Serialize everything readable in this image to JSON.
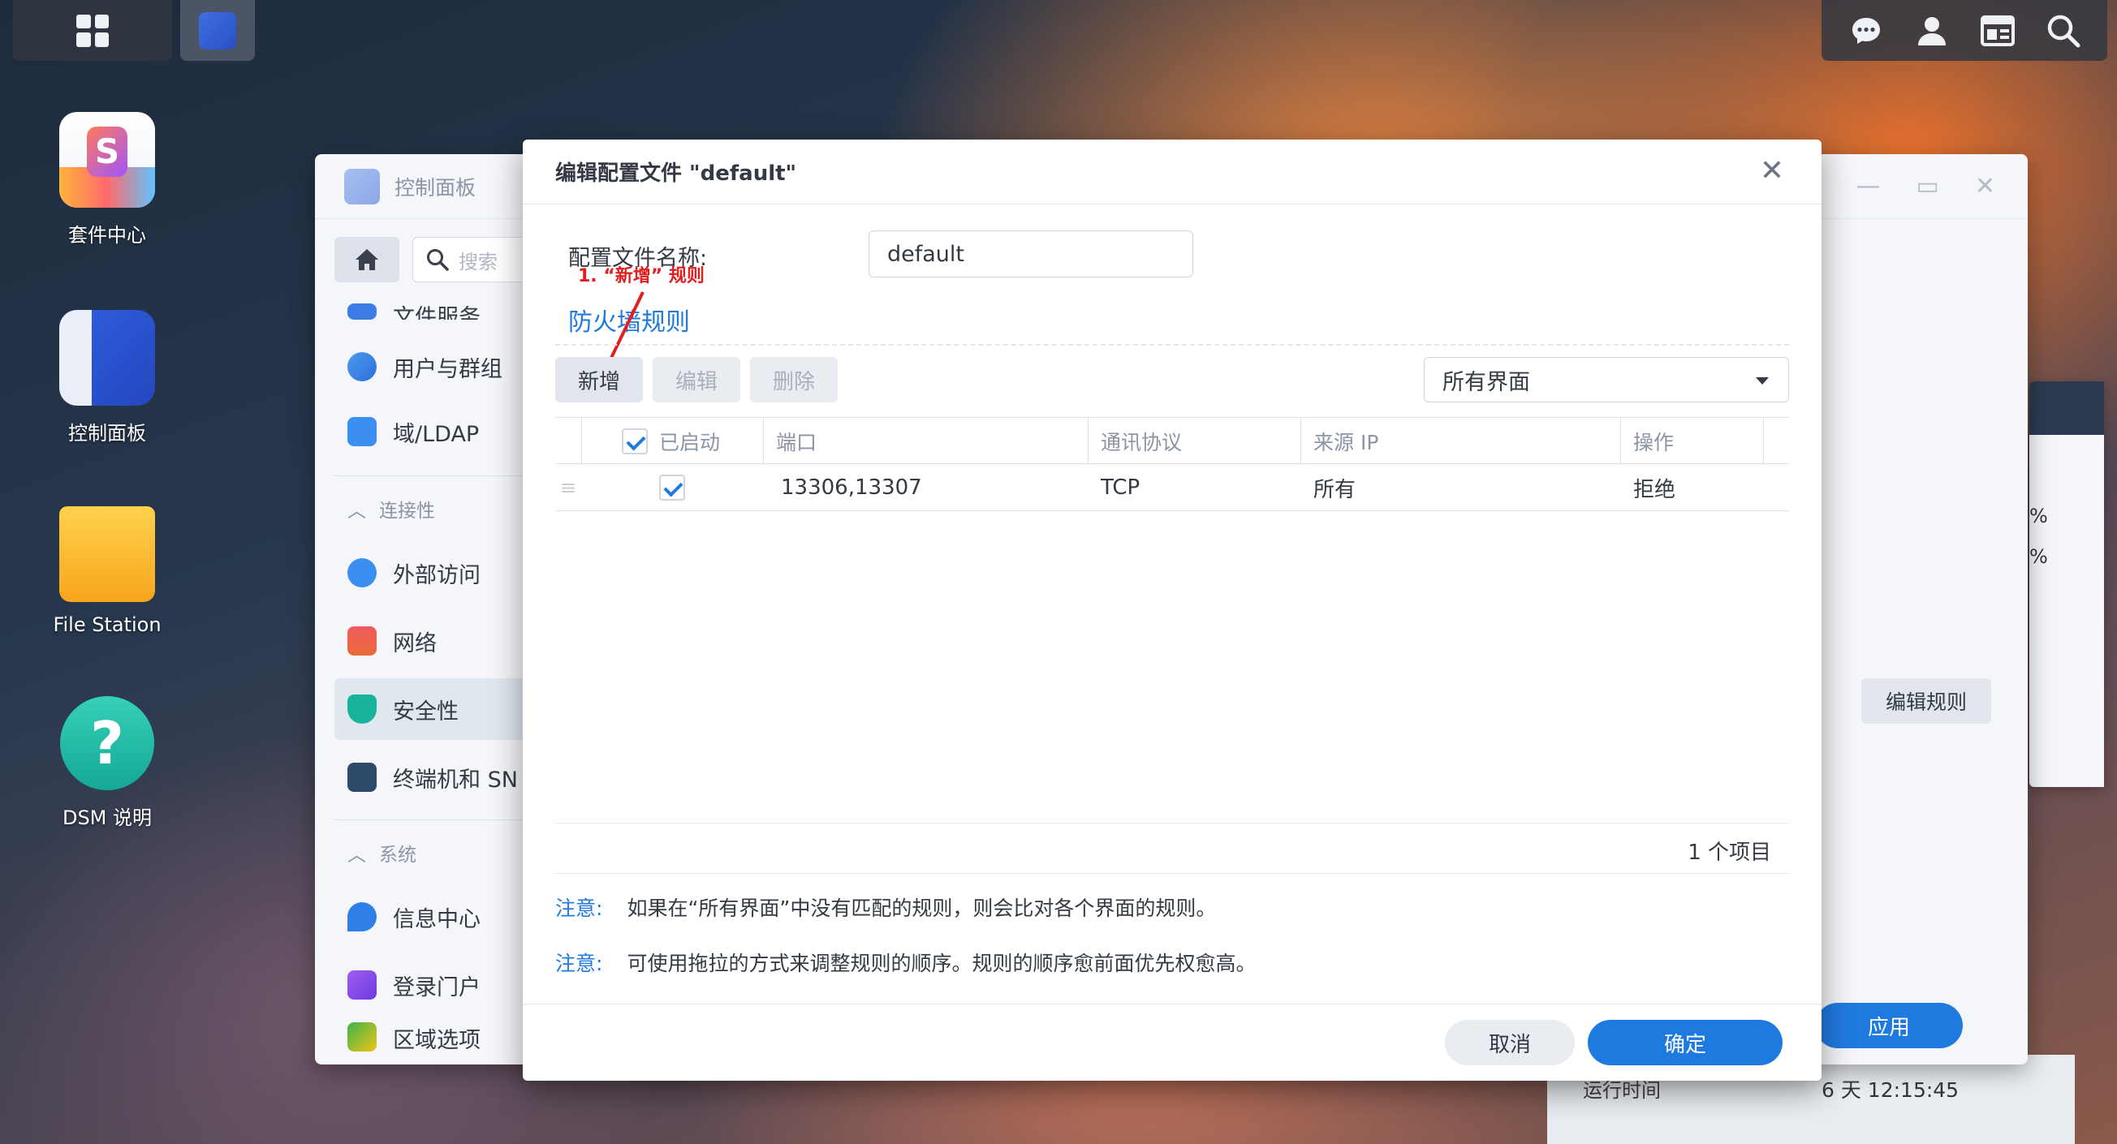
{
  "desktop": {
    "icons": [
      {
        "label": "套件中心"
      },
      {
        "label": "控制面板"
      },
      {
        "label": "File Station"
      },
      {
        "label": "DSM 说明"
      }
    ]
  },
  "control_panel": {
    "title": "控制面板",
    "search_placeholder": "搜索",
    "sidebar": {
      "partial_top_item": "文件服务",
      "items": [
        {
          "label": "用户与群组"
        },
        {
          "label": "域/LDAP"
        }
      ],
      "section_connectivity": "连接性",
      "connectivity_items": [
        {
          "label": "外部访问"
        },
        {
          "label": "网络"
        },
        {
          "label": "安全性"
        },
        {
          "label": "终端机和 SN"
        }
      ],
      "section_system": "系统",
      "system_items": [
        {
          "label": "信息中心"
        },
        {
          "label": "登录门户"
        },
        {
          "label": "区域选项"
        }
      ]
    },
    "edit_rules_label": "编辑规则",
    "apply_label": "应用",
    "runtime_label": "运行时间",
    "runtime_value": "6 天 12:15:45",
    "widget_text_1": "%",
    "widget_text_2": "%"
  },
  "modal": {
    "title": "编辑配置文件 \"default\"",
    "profile_name_label": "配置文件名称:",
    "profile_name_value": "default",
    "annotation": "1. “新增” 规则",
    "section_title": "防火墙规则",
    "toolbar": {
      "new_label": "新增",
      "edit_label": "编辑",
      "delete_label": "删除"
    },
    "interface_select": "所有界面",
    "table": {
      "headers": {
        "enabled": "已启动",
        "port": "端口",
        "protocol": "通讯协议",
        "source_ip": "来源 IP",
        "action": "操作"
      },
      "rows": [
        {
          "port": "13306,13307",
          "protocol": "TCP",
          "source_ip": "所有",
          "action": "拒绝"
        }
      ]
    },
    "item_count": "1 个项目",
    "notes": [
      {
        "label": "注意:",
        "text": "如果在“所有界面”中没有匹配的规则，则会比对各个界面的规则。"
      },
      {
        "label": "注意:",
        "text": "可使用拖拉的方式来调整规则的顺序。规则的顺序愈前面优先权愈高。"
      }
    ],
    "cancel_label": "取消",
    "ok_label": "确定"
  }
}
